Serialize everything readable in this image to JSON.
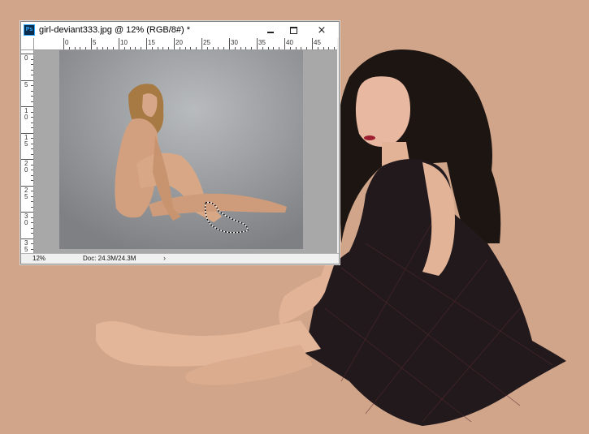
{
  "window": {
    "app_icon": "Ps",
    "title": "girl-deviant333.jpg @ 12% (RGB/8#) *",
    "controls": {
      "minimize": "minimize-icon",
      "maximize": "maximize-icon",
      "close": "×"
    }
  },
  "rulers": {
    "top_labels": [
      "0",
      "5",
      "10",
      "15",
      "20",
      "25",
      "30",
      "35",
      "40",
      "45"
    ],
    "left_labels": [
      "0",
      "5",
      "10",
      "15",
      "20",
      "25",
      "30",
      "35"
    ]
  },
  "status": {
    "zoom": "12%",
    "doc_info": "Doc: 24.3M/24.3M",
    "arrow": "›"
  },
  "colors": {
    "background": "#d0a58a",
    "canvas_bg": "#a8a8a8",
    "photo_bg": "#8f9194",
    "dress": "#22191d",
    "skin": "#e2b396",
    "hair": "#1d1512",
    "accent_blue": "#31a8ff"
  }
}
